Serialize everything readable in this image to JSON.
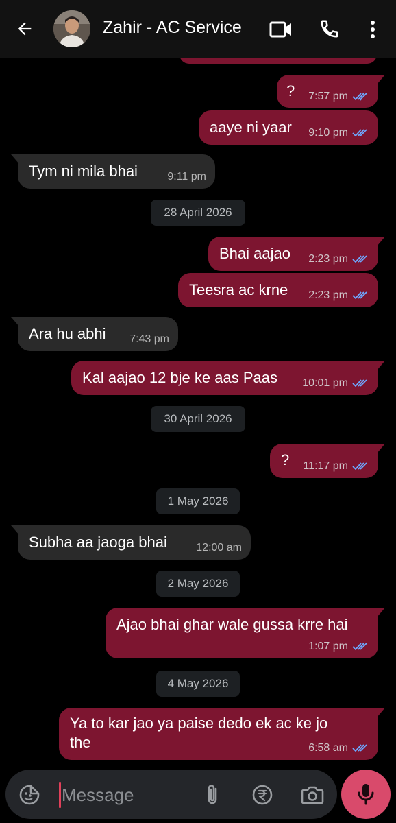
{
  "header": {
    "contact_name": "Zahir - AC Service"
  },
  "messages": [
    {
      "id": "m1",
      "dir": "out",
      "text": "?",
      "time": "7:57 pm",
      "read": true
    },
    {
      "id": "m2",
      "dir": "out",
      "text": "aaye ni yaar",
      "time": "9:10 pm",
      "read": true
    },
    {
      "id": "m3",
      "dir": "in",
      "text": "Tym ni mila bhai",
      "time": "9:11 pm"
    },
    {
      "id": "d1",
      "type": "date",
      "text": "28 April 2026"
    },
    {
      "id": "m4",
      "dir": "out",
      "text": "Bhai aajao",
      "time": "2:23 pm",
      "read": true
    },
    {
      "id": "m5",
      "dir": "out",
      "text": "Teesra ac krne",
      "time": "2:23 pm",
      "read": true
    },
    {
      "id": "m6",
      "dir": "in",
      "text": "Ara hu abhi",
      "time": "7:43 pm"
    },
    {
      "id": "m7",
      "dir": "out",
      "text": "Kal aajao 12 bje ke aas Paas",
      "time": "10:01 pm",
      "read": true
    },
    {
      "id": "d2",
      "type": "date",
      "text": "30 April 2026"
    },
    {
      "id": "m8",
      "dir": "out",
      "text": "?",
      "time": "11:17 pm",
      "read": true
    },
    {
      "id": "d3",
      "type": "date",
      "text": "1 May 2026"
    },
    {
      "id": "m9",
      "dir": "in",
      "text": "Subha aa jaoga bhai",
      "time": "12:00 am"
    },
    {
      "id": "d4",
      "type": "date",
      "text": "2 May 2026"
    },
    {
      "id": "m10",
      "dir": "out",
      "text": "Ajao bhai ghar wale gussa krre hai",
      "time": "1:07 pm",
      "read": true
    },
    {
      "id": "d5",
      "type": "date",
      "text": "4 May 2026"
    },
    {
      "id": "m11",
      "dir": "out",
      "text_line1": "Ya to kar jao ya paise dedo ek ac ke jo",
      "text_line2": "the",
      "time": "6:58 am",
      "read": true
    }
  ],
  "composer": {
    "placeholder": "Message"
  },
  "icons": {
    "back": "arrow-left-icon",
    "video": "video-camera-icon",
    "call": "phone-icon",
    "more": "more-vertical-icon",
    "sticker": "sticker-icon",
    "attach": "paperclip-icon",
    "payment": "rupee-icon",
    "camera": "camera-icon",
    "mic": "microphone-icon",
    "read_receipt": "double-check-icon"
  },
  "colors": {
    "outgoing_bubble": "#7d1530",
    "incoming_bubble": "#2a2a2a",
    "read_ticks": "#6ea8ff",
    "mic_button": "#d94a6b"
  }
}
